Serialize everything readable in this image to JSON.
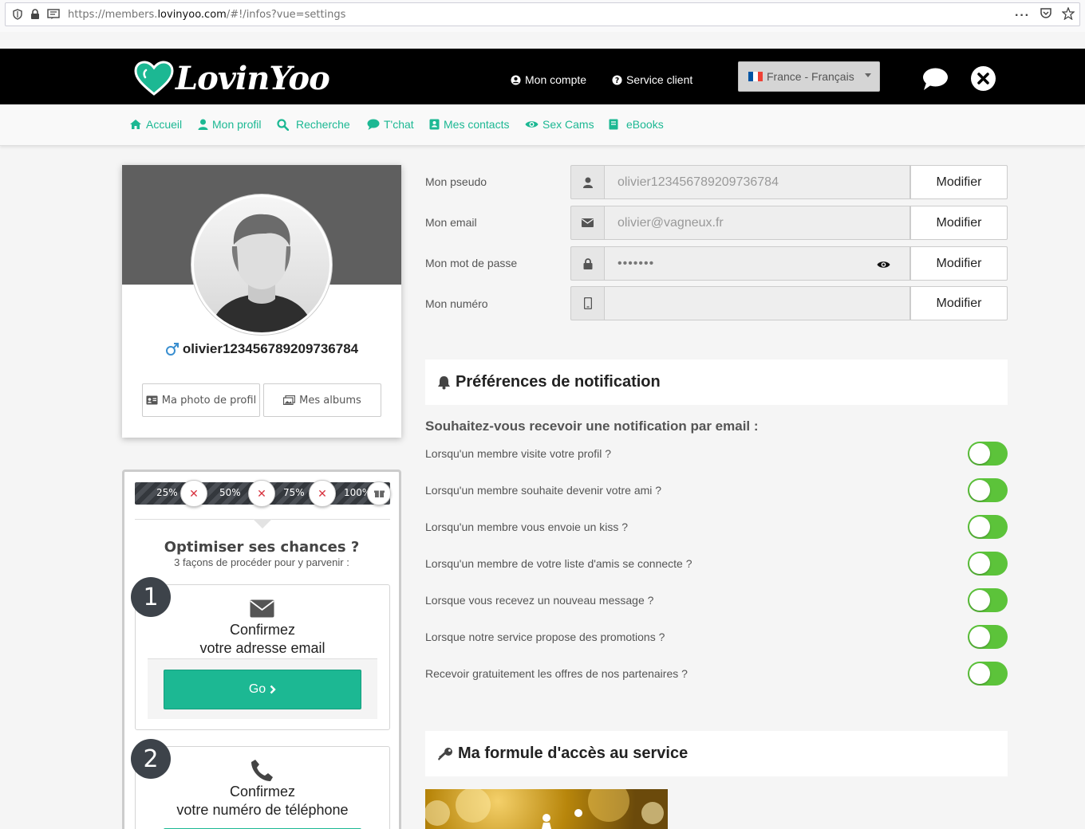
{
  "browser": {
    "url_prefix": "https://members.",
    "url_domain": "lovinyoo.com",
    "url_suffix": "/#!/infos?vue=settings"
  },
  "header": {
    "logo": "LovinYoo",
    "account_link": "Mon compte",
    "support_link": "Service client",
    "language": "France - Français"
  },
  "nav": [
    {
      "label": "Accueil",
      "icon": "home-icon"
    },
    {
      "label": "Mon profil",
      "icon": "user-icon"
    },
    {
      "label": "Recherche",
      "icon": "search-icon"
    },
    {
      "label": "T'chat",
      "icon": "chat-icon"
    },
    {
      "label": "Mes contacts",
      "icon": "contacts-icon"
    },
    {
      "label": "Sex Cams",
      "icon": "eye-icon"
    },
    {
      "label": "eBooks",
      "icon": "book-icon"
    }
  ],
  "profile": {
    "username": "olivier123456789209736784",
    "photo_button": "Ma photo de profil",
    "albums_button": "Mes albums"
  },
  "progress": {
    "steps": [
      "25%",
      "50%",
      "75%",
      "100%"
    ],
    "title": "Optimiser ses chances ?",
    "subtitle": "3 façons de procéder pour y parvenir :",
    "step1": {
      "num": "1",
      "line1": "Confirmez",
      "line2": "votre adresse email",
      "button": "Go"
    },
    "step2": {
      "num": "2",
      "line1": "Confirmez",
      "line2": "votre numéro de téléphone"
    }
  },
  "form": {
    "pseudo": {
      "label": "Mon pseudo",
      "value": "olivier123456789209736784",
      "button": "Modifier"
    },
    "email": {
      "label": "Mon email",
      "value": "olivier@vagneux.fr",
      "button": "Modifier"
    },
    "password": {
      "label": "Mon mot de passe",
      "value": "•••••••",
      "button": "Modifier"
    },
    "phone": {
      "label": "Mon numéro",
      "value": "",
      "button": "Modifier"
    }
  },
  "notifications": {
    "title": "Préférences de notification",
    "question": "Souhaitez-vous recevoir une notification par email :",
    "items": [
      {
        "label": "Lorsqu'un membre visite votre profil ?",
        "enabled": true
      },
      {
        "label": "Lorsqu'un membre souhaite devenir votre ami ?",
        "enabled": true
      },
      {
        "label": "Lorsqu'un membre vous envoie un kiss ?",
        "enabled": true
      },
      {
        "label": "Lorsqu'un membre de votre liste d'amis se connecte ?",
        "enabled": true
      },
      {
        "label": "Lorsque vous recevez un nouveau message ?",
        "enabled": true
      },
      {
        "label": "Lorsque notre service propose des promotions ?",
        "enabled": true
      },
      {
        "label": "Recevoir gratuitement les offres de nos partenaires ?",
        "enabled": true
      }
    ]
  },
  "access": {
    "title": "Ma formule d'accès au service"
  },
  "colors": {
    "accent": "#1cb893",
    "toggle_on": "#5cc33a",
    "header_bg": "#000000",
    "step_badge": "#3d434a"
  }
}
